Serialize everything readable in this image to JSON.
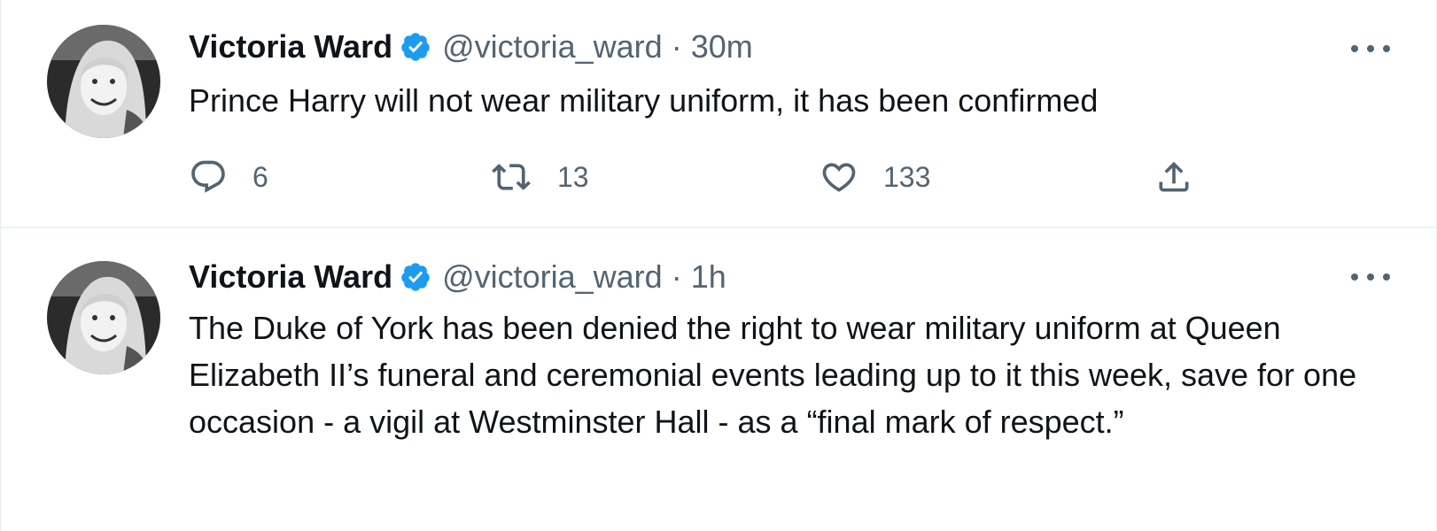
{
  "tweets": [
    {
      "author_name": "Victoria Ward",
      "handle": "@victoria_ward",
      "separator": "·",
      "time": "30m",
      "text": "Prince Harry will not wear military uniform, it has been confirmed",
      "replies": "6",
      "retweets": "13",
      "likes": "133"
    },
    {
      "author_name": "Victoria Ward",
      "handle": "@victoria_ward",
      "separator": "·",
      "time": "1h",
      "text": "The Duke of York has been denied the right to wear military uniform at Queen Elizabeth II’s funeral and ceremonial events leading up to it this week, save for one occasion - a vigil at Westminster Hall - as a “final mark of respect.”"
    }
  ],
  "colors": {
    "verified": "#1d9bf0",
    "secondary_text": "#536471",
    "primary_text": "#0f1419",
    "divider": "#eff3f4"
  },
  "icons": [
    "verified-badge-icon",
    "more-icon",
    "reply-icon",
    "retweet-icon",
    "like-icon",
    "share-icon"
  ]
}
